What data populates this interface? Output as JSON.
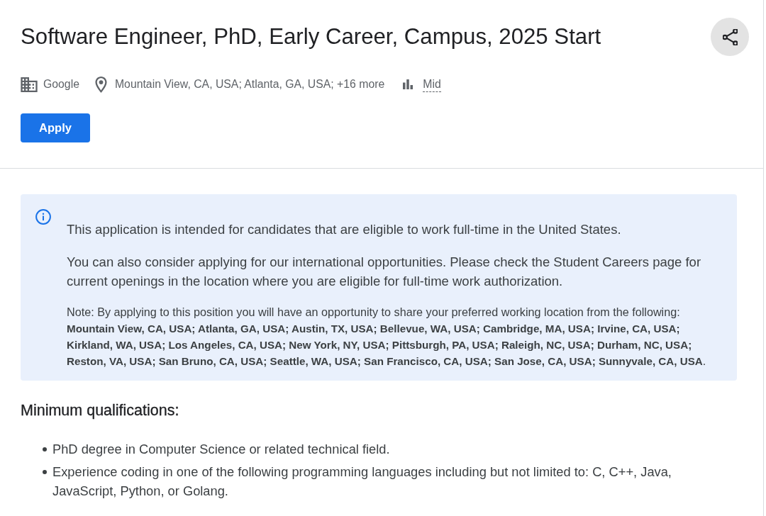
{
  "job_header": {
    "title": "Software Engineer, PhD, Early Career, Campus, 2025 Start",
    "meta": [
      {
        "kind": "company",
        "text": "Google"
      },
      {
        "kind": "location",
        "text": "Mountain View, CA, USA; Atlanta, GA, USA; +16 more"
      },
      {
        "kind": "level",
        "text": "Mid"
      }
    ],
    "apply_button": "Apply"
  },
  "notice": {
    "paragraphs": [
      {
        "kind": "body",
        "text": "This application is intended for candidates that are eligible to work full-time in the United States."
      },
      {
        "kind": "body",
        "text": "You can also consider applying for our international opportunities. Please check the Student Careers page for current openings in the location where you are eligible for full-time work authorization."
      },
      {
        "kind": "note",
        "text": "Note: By applying to this position you will have an opportunity to share your preferred working location from the following: **Mountain View, CA, USA; Atlanta, GA, USA; Austin, TX, USA; Bellevue, WA, USA; Cambridge, MA, USA; Irvine, CA, USA; Kirkland, WA, USA; Los Angeles, CA, USA; New York, NY, USA; Pittsburgh, PA, USA; Raleigh, NC, USA; Durham, NC, USA; Reston, VA, USA; San Bruno, CA, USA; Seattle, WA, USA; San Francisco, CA, USA; San Jose, CA, USA; Sunnyvale, CA, USA**."
      }
    ]
  },
  "minimum_qualifications": {
    "heading": "Minimum qualifications:",
    "items": [
      "PhD degree in Computer Science or related technical field.",
      "Experience coding in one of the following programming languages including but not limited to: C, C++, Java, JavaScript, Python, or Golang."
    ]
  }
}
